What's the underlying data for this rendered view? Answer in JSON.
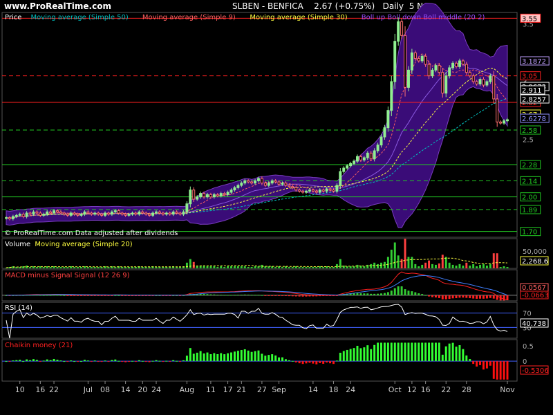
{
  "header": {
    "brand": "www.ProRealTime.com",
    "symbol": "SLBEN - BENFICA",
    "quote": "2.67 (+0.75%)",
    "period": "Daily",
    "date": "5 Nov"
  },
  "colors": {
    "background": "#000000",
    "bull_candle": "#90ee90",
    "bear_candle": "#ff7070",
    "ma50": "#00c0c0",
    "ma9": "#ff6060",
    "ma30": "#ffff40",
    "bollinger_fill": "#3a0c78",
    "volume_bar": "#33cc33",
    "volume_bar_down": "#ff4040",
    "macd_positive": "#33cc33",
    "macd_negative": "#ff2020",
    "chaikin_positive": "#33ff33",
    "chaikin_negative": "#ff1010",
    "rsi_line": "#ffffff",
    "level_green": "#22cc22",
    "level_red": "#ff2020"
  },
  "chart_data": [
    {
      "type": "candlestick",
      "panel": "price",
      "legend": [
        {
          "label": "Price",
          "color": "#ffffff"
        },
        {
          "label": "Moving average (Simple 50)",
          "color": "#00c0c0"
        },
        {
          "label": "Moving average (Simple 9)",
          "color": "#ff6060"
        },
        {
          "label": "Moving average (Simple 30)",
          "color": "#ffff40"
        },
        {
          "label": "Boll up Boll down Boll middle (20 2)",
          "color": "#9a4dff"
        }
      ],
      "footnote": "© ProRealTime.com Data adjusted after dividends",
      "ylim": [
        1.65,
        3.6
      ],
      "y_ticks": [
        "3.5",
        "3",
        "2.5",
        "2"
      ],
      "x_ticks": [
        "10",
        "16",
        "22",
        "Jul",
        "08",
        "14",
        "20",
        "24",
        "Aug",
        "11",
        "17",
        "21",
        "27",
        "Sep",
        "14",
        "18",
        "24",
        "Oct",
        "12",
        "16",
        "22",
        "28",
        "Nov"
      ],
      "levels": [
        {
          "label": "3.55",
          "value": 3.55,
          "color": "#ff2020",
          "style": "solid",
          "highlight": true
        },
        {
          "label": "3.05",
          "value": 3.05,
          "color": "#ff2020",
          "style": "dashed"
        },
        {
          "label": "2.82",
          "value": 2.82,
          "color": "#ff2020",
          "style": "solid"
        },
        {
          "label": "2.58",
          "value": 2.58,
          "color": "#22cc22",
          "style": "dashed"
        },
        {
          "label": "2.28",
          "value": 2.28,
          "color": "#22cc22",
          "style": "solid"
        },
        {
          "label": "2.14",
          "value": 2.14,
          "color": "#22cc22",
          "style": "dashed"
        },
        {
          "label": "2.00",
          "value": 2.0,
          "color": "#22cc22",
          "style": "solid"
        },
        {
          "label": "1.89",
          "value": 1.89,
          "color": "#22cc22",
          "style": "dashed"
        },
        {
          "label": "1.70",
          "value": 1.7,
          "color": "#22cc22",
          "style": "solid"
        }
      ],
      "last_values": [
        {
          "label": "3.1872",
          "color": "#c0a0ff"
        },
        {
          "label": "2.9673",
          "color": "#ffffff"
        },
        {
          "label": "2.911",
          "color": "#ffffff"
        },
        {
          "label": "2.8257",
          "color": "#ffffff"
        },
        {
          "label": "2.67",
          "color": "#ffff40"
        },
        {
          "label": "2.6278",
          "color": "#9090ff"
        }
      ],
      "close": [
        1.82,
        1.81,
        1.83,
        1.84,
        1.85,
        1.83,
        1.86,
        1.85,
        1.87,
        1.86,
        1.84,
        1.85,
        1.87,
        1.86,
        1.88,
        1.87,
        1.86,
        1.85,
        1.84,
        1.86,
        1.85,
        1.84,
        1.85,
        1.87,
        1.86,
        1.85,
        1.86,
        1.85,
        1.84,
        1.86,
        1.85,
        1.87,
        1.88,
        1.86,
        1.85,
        1.84,
        1.85,
        1.86,
        1.85,
        1.87,
        1.86,
        1.85,
        1.84,
        1.86,
        1.87,
        1.86,
        1.85,
        1.86,
        1.85,
        1.87,
        1.86,
        1.85,
        1.87,
        1.94,
        2.06,
        1.98,
        2.0,
        2.03,
        2.0,
        2.02,
        2.0,
        2.02,
        2.01,
        2.03,
        2.02,
        2.04,
        2.06,
        2.08,
        2.1,
        2.12,
        2.14,
        2.13,
        2.12,
        2.14,
        2.16,
        2.12,
        2.1,
        2.12,
        2.14,
        2.13,
        2.11,
        2.12,
        2.1,
        2.09,
        2.08,
        2.06,
        2.05,
        2.04,
        2.05,
        2.06,
        2.05,
        2.04,
        2.06,
        2.05,
        2.07,
        2.06,
        2.05,
        2.1,
        2.22,
        2.25,
        2.27,
        2.29,
        2.31,
        2.35,
        2.32,
        2.34,
        2.38,
        2.33,
        2.4,
        2.45,
        2.52,
        2.6,
        2.75,
        3.0,
        3.35,
        3.52,
        3.4,
        2.95,
        3.1,
        3.25,
        3.2,
        3.18,
        3.22,
        3.15,
        3.05,
        3.1,
        3.14,
        3.08,
        2.9,
        3.05,
        3.12,
        3.16,
        3.13,
        3.18,
        3.15,
        3.08,
        3.05,
        3.0,
        2.98,
        3.02,
        2.97,
        3.0,
        3.05,
        2.85,
        2.65,
        2.64,
        2.66,
        2.67
      ],
      "series": [
        {
          "name": "Moving average (Simple 50)",
          "values": []
        },
        {
          "name": "Moving average (Simple 9)",
          "values": []
        },
        {
          "name": "Moving average (Simple 30)",
          "values": []
        },
        {
          "name": "Boll up Boll down Boll middle (20 2)",
          "values": []
        }
      ]
    },
    {
      "type": "bar",
      "panel": "volume",
      "legend": [
        {
          "label": "Volume",
          "color": "#ffffff"
        },
        {
          "label": "Moving average (Simple 20)",
          "color": "#ffff40"
        }
      ],
      "y_ticks": [
        "50,000"
      ],
      "last_value": "2,268.6",
      "ylim": [
        0,
        70000
      ]
    },
    {
      "type": "bar",
      "panel": "macd",
      "legend": [
        {
          "label": "MACD minus Signal Signal (12 26 9)",
          "color": "#ff4040"
        }
      ],
      "last_values": [
        {
          "label": "0.0567",
          "color": "#ff6060"
        },
        {
          "label": "-0.0663",
          "color": "#ff2020"
        }
      ]
    },
    {
      "type": "line",
      "panel": "rsi",
      "legend": [
        {
          "label": "RSI (14)",
          "color": "#ffffff"
        }
      ],
      "y_ticks": [
        "70",
        "30"
      ],
      "last_value": "40.738",
      "ylim": [
        0,
        100
      ]
    },
    {
      "type": "bar",
      "panel": "chaikin",
      "legend": [
        {
          "label": "Chaikin money (21)",
          "color": "#ff2020"
        }
      ],
      "y_ticks": [
        "0.5",
        "0"
      ],
      "last_value": "-0.5306",
      "ylim": [
        -0.65,
        0.7
      ]
    }
  ]
}
